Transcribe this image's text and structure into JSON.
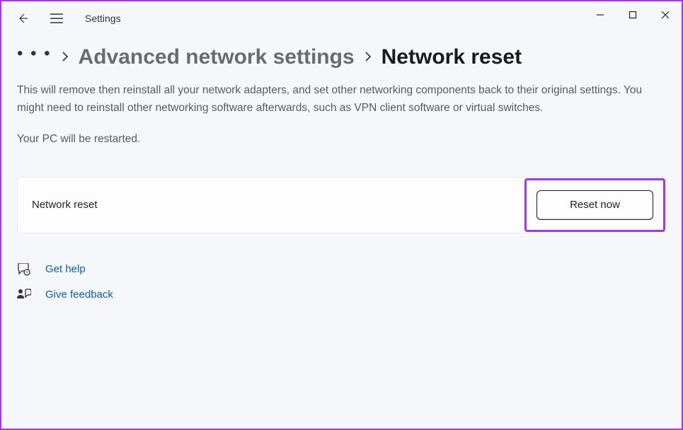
{
  "titlebar": {
    "app_title": "Settings"
  },
  "breadcrumb": {
    "parent": "Advanced network settings",
    "current": "Network reset"
  },
  "main": {
    "description": "This will remove then reinstall all your network adapters, and set other networking components back to their original settings. You might need to reinstall other networking software afterwards, such as VPN client software or virtual switches.",
    "restart_note": "Your PC will be restarted.",
    "reset_row_label": "Network reset",
    "reset_button_label": "Reset now"
  },
  "links": {
    "help": "Get help",
    "feedback": "Give feedback"
  }
}
